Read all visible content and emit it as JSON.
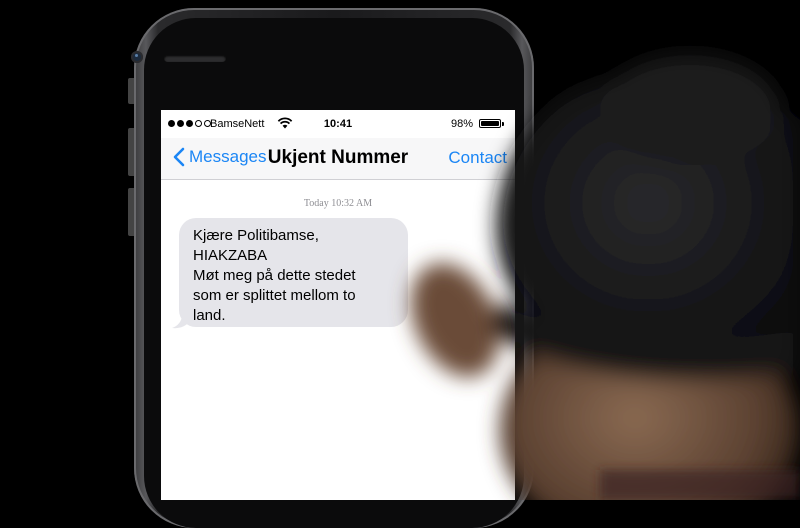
{
  "status_bar": {
    "carrier": "BamseNett",
    "time": "10:41",
    "battery_percent": "98%",
    "battery_level": 0.98,
    "signal_dots_filled": 3,
    "signal_dots_total": 5
  },
  "navbar": {
    "back_label": "Messages",
    "title": "Ukjent Nummer",
    "contact_label": "Contact"
  },
  "conversation": {
    "timestamp": "Today 10:32 AM",
    "messages": [
      {
        "direction": "incoming",
        "lines": [
          "Kjære Politibamse,",
          "HIAKZABA",
          "Møt meg på dette stedet",
          "som er splittet mellom to",
          "land."
        ]
      }
    ]
  },
  "colors": {
    "accent": "#1b86f5",
    "incoming_bubble": "#e5e5ea",
    "background": "#000000"
  },
  "icons": [
    "signal-dots-icon",
    "wifi-icon",
    "battery-icon",
    "chevron-left-icon"
  ]
}
